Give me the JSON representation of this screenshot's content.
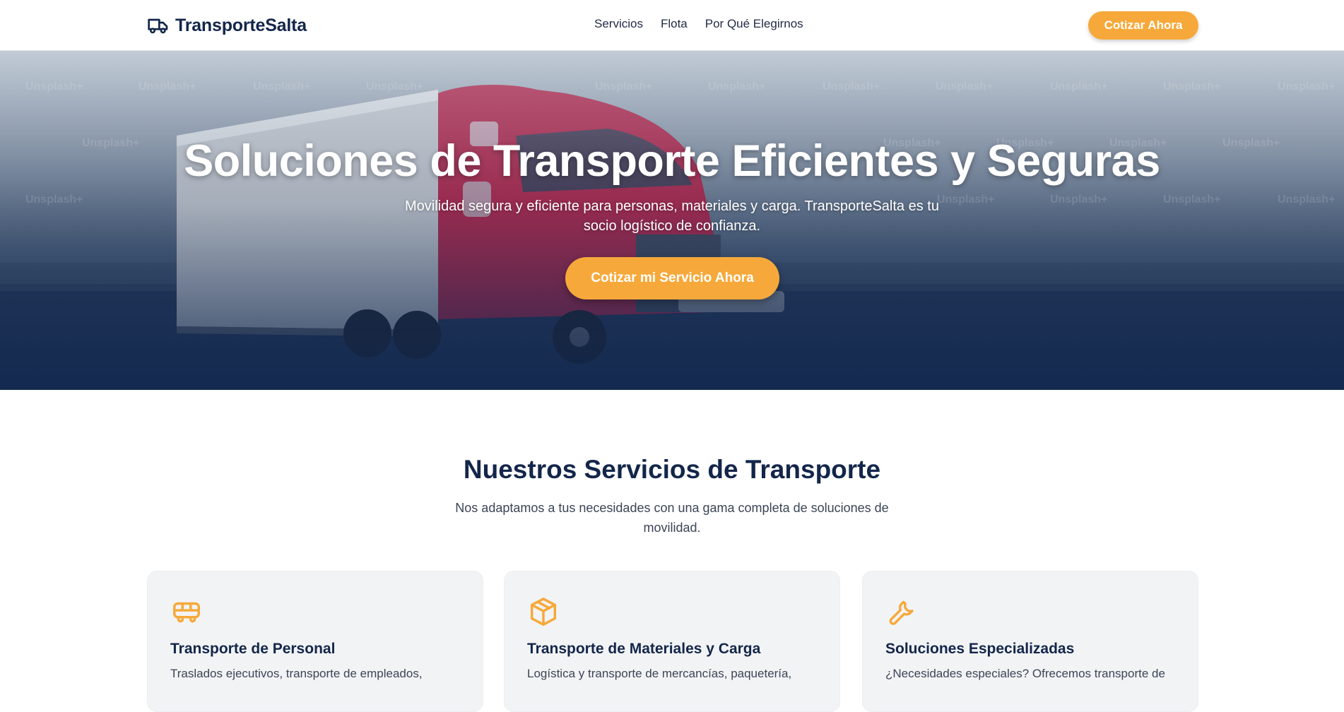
{
  "header": {
    "brand": "TransporteSalta",
    "nav": [
      "Servicios",
      "Flota",
      "Por Qué Elegirnos"
    ],
    "cta_label": "Cotizar Ahora"
  },
  "hero": {
    "title": "Soluciones de Transporte Eficientes y Seguras",
    "subtitle": "Movilidad segura y eficiente para personas, materiales y carga. TransporteSalta es tu socio logístico de confianza.",
    "cta_label": "Cotizar mi Servicio Ahora",
    "watermark": "Unsplash+"
  },
  "services": {
    "title": "Nuestros Servicios de Transporte",
    "subtitle": "Nos adaptamos a tus necesidades con una gama completa de soluciones de movilidad.",
    "cards": [
      {
        "icon": "bus-icon",
        "title": "Transporte de Personal",
        "text": "Traslados ejecutivos, transporte de empleados,"
      },
      {
        "icon": "box-icon",
        "title": "Transporte de Materiales y Carga",
        "text": "Logística y transporte de mercancías, paquetería,"
      },
      {
        "icon": "wrench-icon",
        "title": "Soluciones Especializadas",
        "text": "¿Necesidades especiales? Ofrecemos transporte de"
      }
    ]
  },
  "colors": {
    "accent": "#f6a93a",
    "navy": "#13264a",
    "card_bg": "#f2f3f5"
  }
}
